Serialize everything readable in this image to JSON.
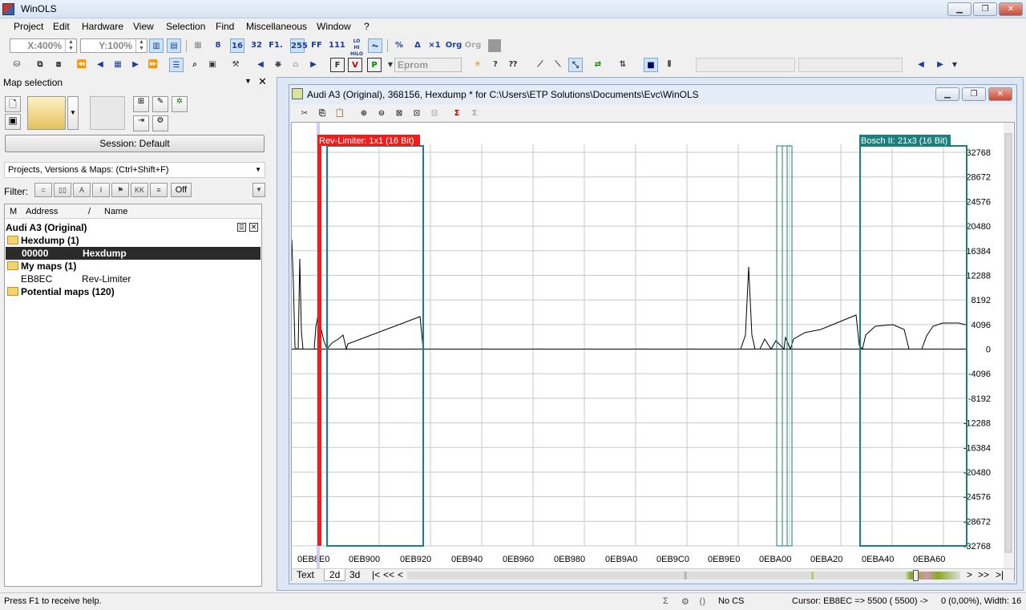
{
  "window": {
    "title": "WinOLS"
  },
  "menu": [
    "Project",
    "Edit",
    "Hardware",
    "View",
    "Selection",
    "Find",
    "Miscellaneous",
    "Window",
    "?"
  ],
  "toolbar": {
    "x_zoom": "X:400%",
    "y_zoom": "Y:100%",
    "eprom_label": "Eprom",
    "icons": [
      "8",
      "16",
      "32",
      "F1.",
      "255",
      "FF",
      "111",
      "LO HI HILO",
      "%",
      "Org",
      "Org"
    ]
  },
  "left_pane": {
    "title": "Map selection",
    "session_label": "Session: Default",
    "pvm_label": "Projects, Versions & Maps:  (Ctrl+Shift+F)",
    "filter_label": "Filter:",
    "filter_off": "Off",
    "tree_headers": {
      "m": "M",
      "address": "Address",
      "sort": "/",
      "name": "Name"
    },
    "project": "Audi A3 (Original)",
    "rows": [
      {
        "type": "folder",
        "text": "Hexdump (1)"
      },
      {
        "type": "item",
        "address": "00000",
        "name": "Hexdump",
        "selected": true
      },
      {
        "type": "folder",
        "text": "My maps (1)"
      },
      {
        "type": "item",
        "address": "EB8EC",
        "name": "Rev-Limiter",
        "selected": false
      },
      {
        "type": "folder",
        "text": "Potential maps (120)"
      }
    ]
  },
  "doc": {
    "title": "Audi A3 (Original), 368156, Hexdump * for C:\\Users\\ETP Solutions\\Documents\\Evc\\WinOLS",
    "map1_label": "Rev-Limiter: 1x1 (16 Bit)",
    "map2_label": "Bosch II: 21x3 (16 Bit)",
    "y_ticks": [
      "32768",
      "28672",
      "24576",
      "20480",
      "16384",
      "12288",
      "8192",
      "4096",
      "0",
      "-4096",
      "-8192",
      "-12288",
      "-16384",
      "-20480",
      "-24576",
      "-28672",
      "-32768"
    ],
    "x_ticks": [
      "0EB8E0",
      "0EB900",
      "0EB920",
      "0EB940",
      "0EB960",
      "0EB980",
      "0EB9A0",
      "0EB9C0",
      "0EB9E0",
      "0EBA00",
      "0EBA20",
      "0EBA40",
      "0EBA60"
    ],
    "tabs": [
      "Text",
      "2d",
      "3d"
    ],
    "nav": [
      "|<",
      "<<",
      "<",
      ">",
      ">>",
      ">|"
    ]
  },
  "status": {
    "help": "Press F1 to receive help.",
    "cs": "No CS",
    "cursor": "Cursor: EB8EC =>  5500 ( 5500) ->",
    "info": "0 (0,00%), Width: 16"
  },
  "colors": {
    "map1": "#e8201e",
    "map2": "#1b7f80",
    "selected_row": "#2b2b2b"
  }
}
